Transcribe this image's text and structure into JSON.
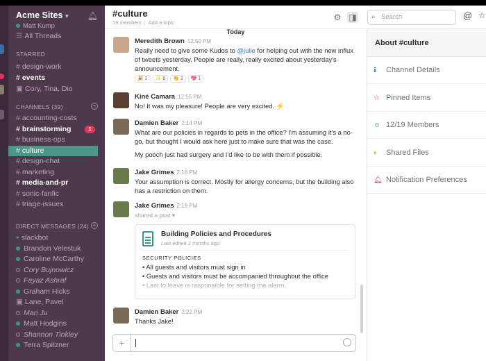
{
  "team": {
    "name": "Acme Sites",
    "user": "Matt Kump"
  },
  "sidebar": {
    "all_threads": "All Threads",
    "starred_heading": "STARRED",
    "starred": [
      {
        "label": "design-work",
        "prefix": "#",
        "style": "normal"
      },
      {
        "label": "events",
        "prefix": "#",
        "style": "bold"
      },
      {
        "label": "Cory, Tina, Dio",
        "prefix": "▣",
        "style": "normal"
      }
    ],
    "channels_heading": "CHANNELS",
    "channels_count": "(39)",
    "channels": [
      {
        "label": "accounting-costs",
        "style": "normal"
      },
      {
        "label": "brainstorming",
        "style": "bold",
        "badge": "1"
      },
      {
        "label": "business-ops",
        "style": "normal"
      },
      {
        "label": "culture",
        "style": "active"
      },
      {
        "label": "design-chat",
        "style": "normal"
      },
      {
        "label": "marketing",
        "style": "normal"
      },
      {
        "label": "media-and-pr",
        "style": "bold"
      },
      {
        "label": "sonic-fanfic",
        "style": "normal"
      },
      {
        "label": "triage-issues",
        "style": "normal"
      }
    ],
    "dm_heading": "DIRECT MESSAGES",
    "dm_count": "(24)",
    "dms": [
      {
        "label": "slackbot",
        "presence": "heart"
      },
      {
        "label": "Brandon Velestuk",
        "presence": "on"
      },
      {
        "label": "Caroline McCarthy",
        "presence": "on"
      },
      {
        "label": "Cory Bujnowicz",
        "presence": "off",
        "italic": true
      },
      {
        "label": "Fayaz Ashraf",
        "presence": "off",
        "italic": true
      },
      {
        "label": "Graham Hicks",
        "presence": "on"
      },
      {
        "label": "Lane, Pavel",
        "presence": "group"
      },
      {
        "label": "Mari Ju",
        "presence": "off",
        "italic": true
      },
      {
        "label": "Matt Hodgins",
        "presence": "on"
      },
      {
        "label": "Shannon Tinkley",
        "presence": "off",
        "italic": true
      },
      {
        "label": "Terra Spitzner",
        "presence": "on"
      }
    ]
  },
  "channel": {
    "title": "#culture",
    "members": "19 members",
    "topic_placeholder": "Add a topic"
  },
  "search": {
    "placeholder": "Search"
  },
  "divider": "Today",
  "messages": [
    {
      "author": "Meredith Brown",
      "time": "12:50 PM",
      "text_before": "Really need to give some Kudos to ",
      "mention": "@julie",
      "text_after": " for helping out with the new influx of tweets yesterday. People are really, really excited about yesterday's announcement.",
      "reactions": [
        "🎉 2",
        "✨ 8",
        "👏 3",
        "💖 1"
      ]
    },
    {
      "author": "Kiné Camara",
      "time": "12:55 PM",
      "text": "No! It was my pleasure! People are very excited. ⚡"
    },
    {
      "author": "Damien Baker",
      "time": "2:14 PM",
      "text": "What are our policies in regards to pets in the office? I'm assuming it's a no-go, but thought I would ask here just to make sure that was the case.",
      "text2": "My pooch just had surgery and I'd like to be with them if possible."
    },
    {
      "author": "Jake Grimes",
      "time": "2:18 PM",
      "text": "Your assumption is correct. Mostly for allergy concerns, but the building also has a restriction on them."
    },
    {
      "author": "Jake Grimes",
      "time": "2:19 PM",
      "shared_label": "shared a post ▾",
      "post": {
        "title": "Building Policies and Procedures",
        "subtitle": "Last edited 2 months ago",
        "section": "SECURITY POLICIES",
        "items": [
          "• All guests and visitors must sign in",
          "• Guests and visitors must be accompanied throughout the office",
          "• Last to leave is responsible for setting the alarm."
        ]
      }
    },
    {
      "author": "Damien Baker",
      "time": "2:22 PM",
      "text": "Thanks Jake!"
    }
  ],
  "panel": {
    "title": "About #culture",
    "items": [
      {
        "label": "Channel Details",
        "icon": "info-icon",
        "color": "#2a80b9"
      },
      {
        "label": "Pinned Items",
        "icon": "pin-icon",
        "color": "#e0365a"
      },
      {
        "label": "12/19 Members",
        "icon": "members-icon",
        "color": "#38978d"
      },
      {
        "label": "Shared Files",
        "icon": "files-icon",
        "color": "#e8a723"
      },
      {
        "label": "Notification Preferences",
        "icon": "bell-icon",
        "color": "#e0365a"
      }
    ]
  },
  "colors": {
    "sidebar": "#4d394b",
    "active": "#4c9689",
    "badge": "#e0365a",
    "link": "#2a80b9"
  }
}
